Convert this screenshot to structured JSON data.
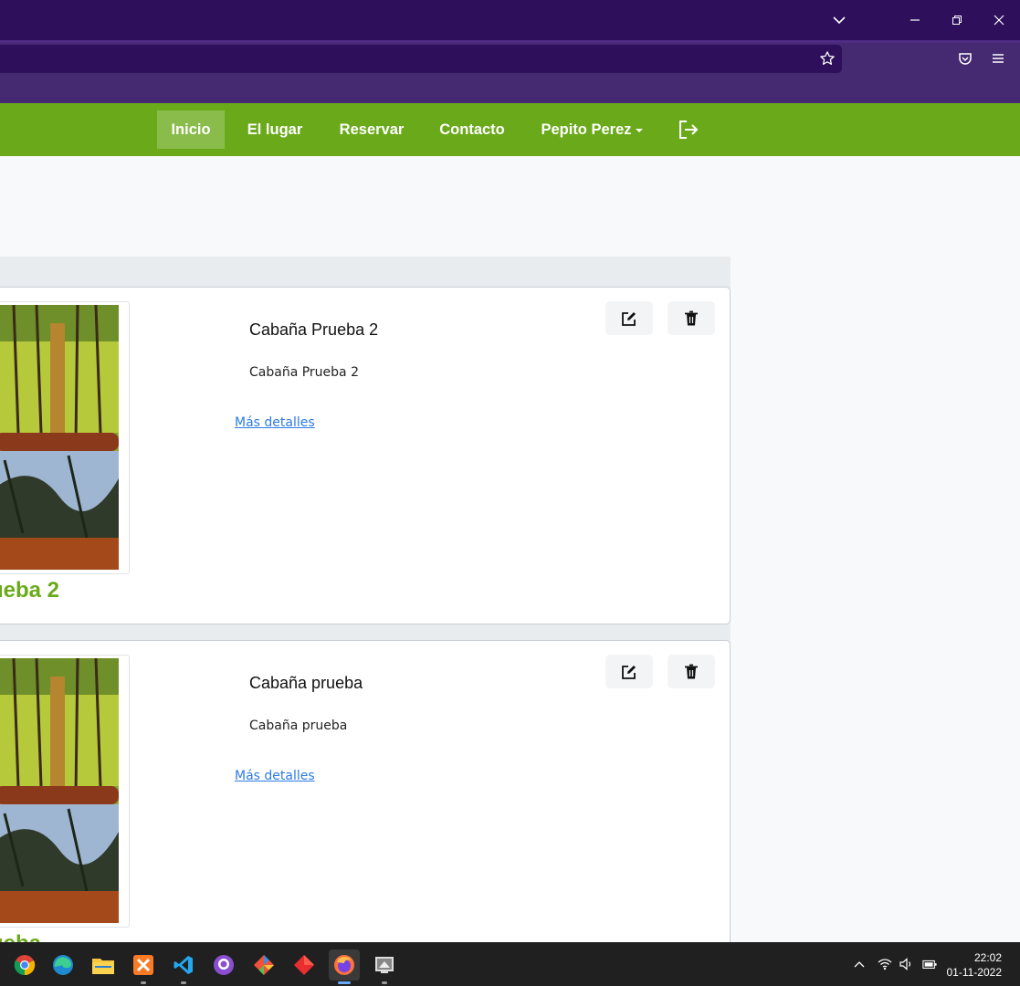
{
  "browser": {
    "chrome_color": "#2d0f5c",
    "toolbar_color": "#452a72"
  },
  "navbar": {
    "color": "#6aaa1a",
    "items": [
      {
        "label": "Inicio",
        "active": true
      },
      {
        "label": "El lugar"
      },
      {
        "label": "Reservar"
      },
      {
        "label": "Contacto"
      }
    ],
    "user_menu": "Pepito Perez",
    "logout_icon": "logout-icon"
  },
  "cards": [
    {
      "image_caption": "ueba 2",
      "title": "Cabaña Prueba 2",
      "description": "Cabaña Prueba 2",
      "link": "Más detalles"
    },
    {
      "image_caption": "ueba",
      "title": "Cabaña prueba",
      "description": "Cabaña prueba",
      "link": "Más detalles"
    }
  ],
  "taskbar": {
    "apps": [
      "chrome",
      "edge",
      "file-explorer",
      "xampp",
      "vscode",
      "github-desktop",
      "git",
      "app-red",
      "firefox",
      "virtual-machine"
    ],
    "time": "22:02",
    "date": "01-11-2022"
  }
}
